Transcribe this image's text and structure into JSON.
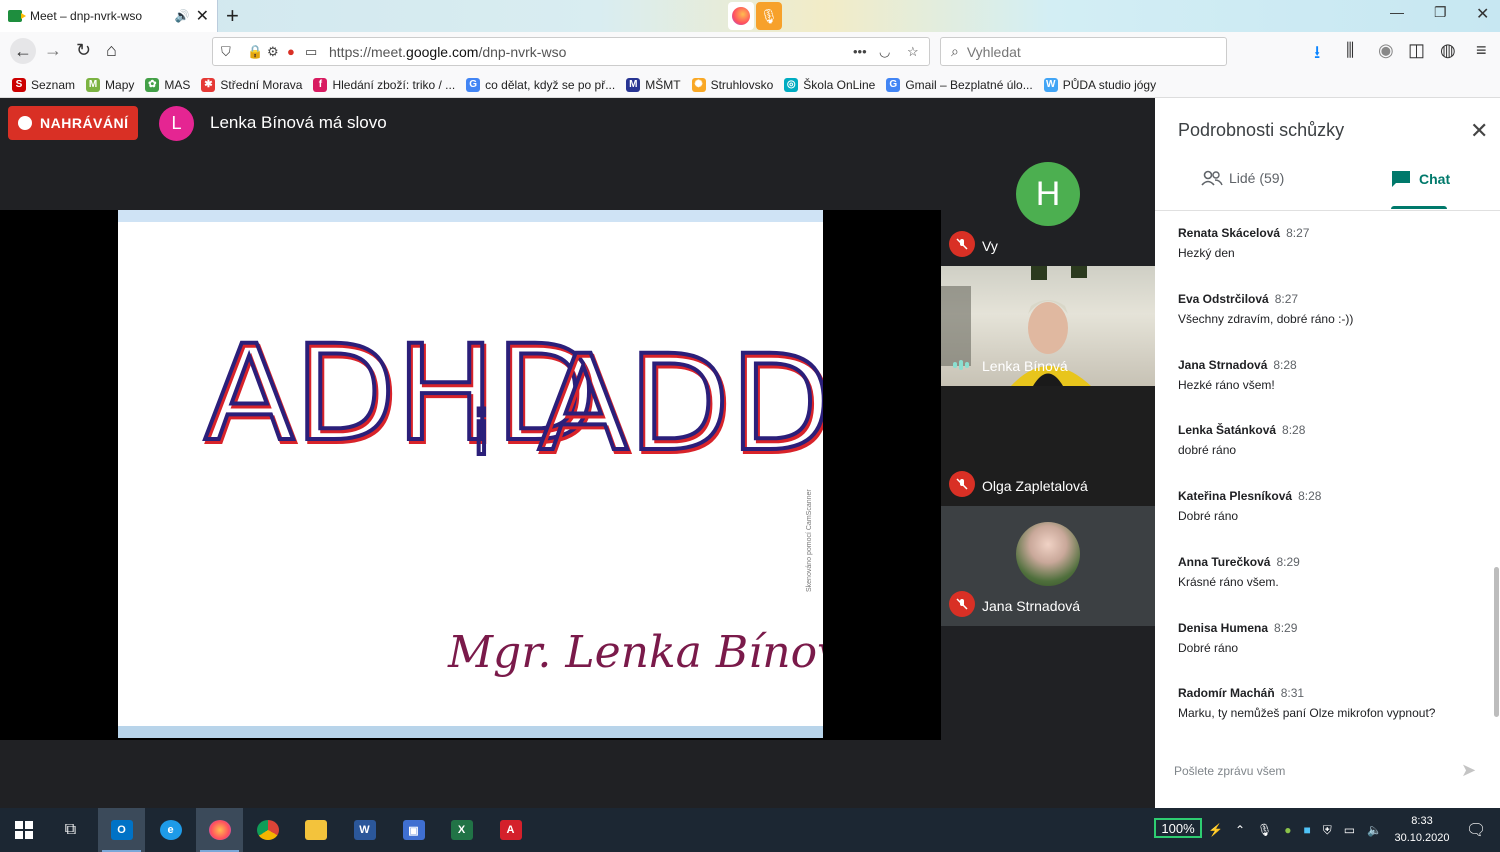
{
  "browser": {
    "tab_title": "Meet – dnp-nvrk-wso",
    "tab_audio": "🔊",
    "url_prefix": "https://meet.",
    "url_domain": "google.com",
    "url_path": "/dnp-nvrk-wso",
    "search_placeholder": "Vyhledat",
    "bookmarks": [
      {
        "label": "Seznam",
        "color": "#cc0000",
        "glyph": "S"
      },
      {
        "label": "Mapy",
        "color": "#7cb342",
        "glyph": "M"
      },
      {
        "label": "MAS",
        "color": "#43a047",
        "glyph": "✿"
      },
      {
        "label": "Střední Morava",
        "color": "#e53935",
        "glyph": "✱"
      },
      {
        "label": "Hledání zboží: triko / ...",
        "color": "#d81b60",
        "glyph": "f"
      },
      {
        "label": "co dělat, když se po př...",
        "color": "#4285f4",
        "glyph": "G"
      },
      {
        "label": "MŠMT",
        "color": "#283593",
        "glyph": "M"
      },
      {
        "label": "Struhlovsko",
        "color": "#f9a825",
        "glyph": "✺"
      },
      {
        "label": "Škola OnLine",
        "color": "#00acc1",
        "glyph": "◎"
      },
      {
        "label": "Gmail – Bezplatné úlo...",
        "color": "#4285f4",
        "glyph": "G"
      },
      {
        "label": "PŮDA studio jógy",
        "color": "#42a5f5",
        "glyph": "W"
      }
    ]
  },
  "meet": {
    "recording_label": "NAHRÁVÁNÍ",
    "speaker_initial": "L",
    "speaker_text": "Lenka Bínová má slovo",
    "slide": {
      "title_left": "ADHD",
      "title_joiner": "i",
      "title_right": "ADD",
      "author": "Mgr. Lenka Bínová",
      "watermark": "Skenováno pomocí CamScanner"
    },
    "participants": [
      {
        "name": "Vy",
        "initial": "H",
        "muted": true
      },
      {
        "name": "Lenka Bínová",
        "muted": false
      },
      {
        "name": "Olga Zapletalová",
        "muted": true
      },
      {
        "name": "Jana Strnadová",
        "muted": true
      }
    ]
  },
  "panel": {
    "title": "Podrobnosti schůzky",
    "tab_people": "Lidé (59)",
    "tab_chat": "Chat",
    "messages": [
      {
        "author": "Renata Skácelová",
        "time": "8:27",
        "text": "Hezký den"
      },
      {
        "author": "Eva Odstrčilová",
        "time": "8:27",
        "text": "Všechny zdravím, dobré ráno :-))"
      },
      {
        "author": "Jana Strnadová",
        "time": "8:28",
        "text": "Hezké ráno všem!"
      },
      {
        "author": "Lenka Šatánková",
        "time": "8:28",
        "text": "dobré ráno"
      },
      {
        "author": "Kateřina Plesníková",
        "time": "8:28",
        "text": "Dobré ráno"
      },
      {
        "author": "Anna Turečková",
        "time": "8:29",
        "text": "Krásné ráno všem."
      },
      {
        "author": "Denisa Humena",
        "time": "8:29",
        "text": "Dobré ráno"
      },
      {
        "author": "Radomír Macháň",
        "time": "8:31",
        "text": "Marku, ty nemůžeš paní Olze mikrofon vypnout?"
      }
    ],
    "compose_placeholder": "Pošlete zprávu všem"
  },
  "taskbar": {
    "battery": "100%",
    "time": "8:33",
    "date": "30.10.2020"
  },
  "colors": {
    "recording": "#d93025",
    "chat_accent": "#00796b",
    "speaker_avatar": "#e52592",
    "self_avatar": "#4caf50"
  }
}
